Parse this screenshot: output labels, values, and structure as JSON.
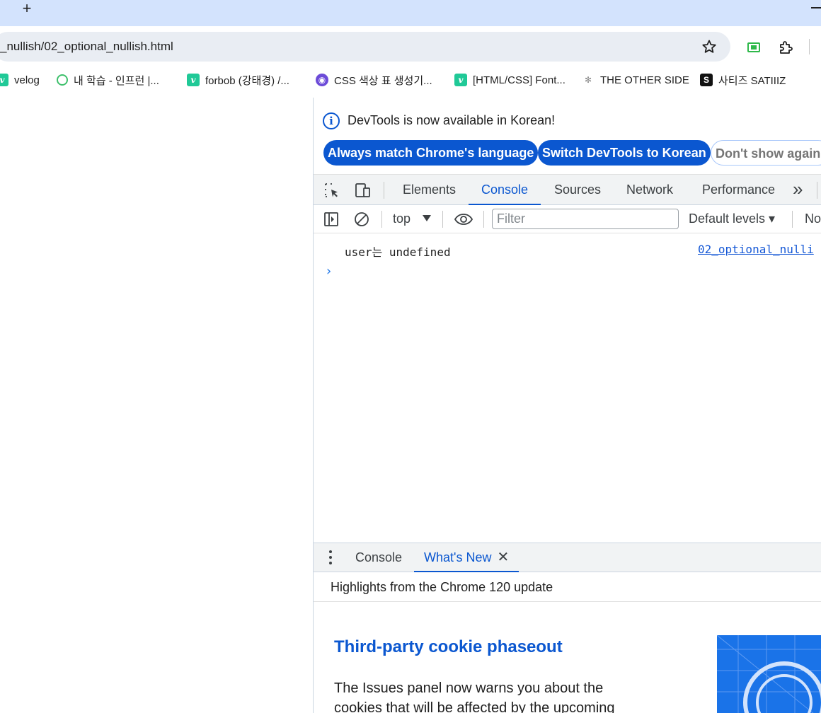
{
  "browser": {
    "new_tab_label": "+",
    "url": "_nullish/02_optional_nullish.html",
    "bookmarks": [
      {
        "label": "velog",
        "icon": "v"
      },
      {
        "label": "내 학습 - 인프런 |...",
        "icon": "inflearn"
      },
      {
        "label": "forbob (강태경) /...",
        "icon": "v"
      },
      {
        "label": "CSS 색상 표 생성기...",
        "icon": "css"
      },
      {
        "label": "[HTML/CSS] Font...",
        "icon": "v"
      },
      {
        "label": "THE OTHER SIDE",
        "icon": "other"
      },
      {
        "label": "사티즈 SATIIIZ",
        "icon": "S"
      }
    ]
  },
  "devtools": {
    "infobar": {
      "message": "DevTools is now available in Korean!",
      "btn_match": "Always match Chrome's language",
      "btn_switch": "Switch DevTools to Korean",
      "btn_dismiss": "Don't show again"
    },
    "tabs": [
      "Elements",
      "Console",
      "Sources",
      "Network",
      "Performance"
    ],
    "active_tab": "Console",
    "more_tabs": "»",
    "console_toolbar": {
      "context": "top",
      "filter_placeholder": "Filter",
      "levels": "Default levels ▾",
      "issues": "No"
    },
    "console": {
      "log_message": "user는 undefined",
      "log_source": "02_optional_nulli",
      "prompt": "›"
    },
    "drawer": {
      "tab_console": "Console",
      "tab_whats_new": "What's New",
      "close": "✕",
      "header": "Highlights from the Chrome 120 update",
      "article_title": "Third-party cookie phaseout",
      "article_body": "The Issues panel now warns you about the cookies that will be affected by the upcoming"
    }
  },
  "colors": {
    "accent": "#0b57d0",
    "tabstrip": "#d3e3fd",
    "omnibox": "#e9edf3"
  }
}
